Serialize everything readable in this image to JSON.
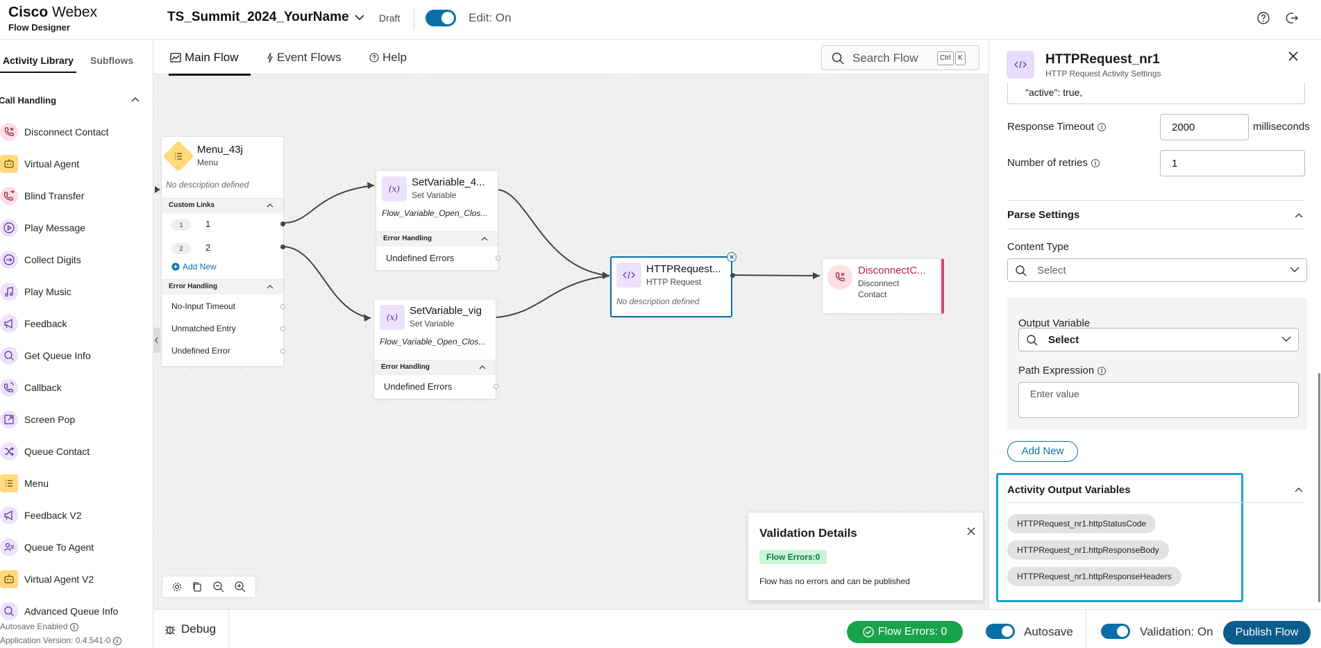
{
  "header": {
    "brand_company": "Cisco",
    "brand_product": "Webex",
    "brand_sub": "Flow Designer",
    "flow_name": "TS_Summit_2024_YourName",
    "status": "Draft",
    "edit_label": "Edit: On"
  },
  "sidebar": {
    "tabs": [
      "Activity Library",
      "Subflows"
    ],
    "category": "Call Handling",
    "items": [
      {
        "label": "Disconnect Contact",
        "icon": "phone-hangup-icon"
      },
      {
        "label": "Virtual Agent",
        "icon": "bot-icon"
      },
      {
        "label": "Blind Transfer",
        "icon": "transfer-icon"
      },
      {
        "label": "Play Message",
        "icon": "play-icon"
      },
      {
        "label": "Collect Digits",
        "icon": "digits-icon"
      },
      {
        "label": "Play Music",
        "icon": "music-icon"
      },
      {
        "label": "Feedback",
        "icon": "megaphone-icon"
      },
      {
        "label": "Get Queue Info",
        "icon": "search-icon"
      },
      {
        "label": "Callback",
        "icon": "callback-icon"
      },
      {
        "label": "Screen Pop",
        "icon": "external-link-icon"
      },
      {
        "label": "Queue Contact",
        "icon": "shuffle-icon"
      },
      {
        "label": "Menu",
        "icon": "menu-icon"
      },
      {
        "label": "Feedback V2",
        "icon": "megaphone-icon"
      },
      {
        "label": "Queue To Agent",
        "icon": "queue-agent-icon"
      },
      {
        "label": "Virtual Agent V2",
        "icon": "bot-icon"
      },
      {
        "label": "Advanced Queue Info",
        "icon": "search-icon"
      }
    ],
    "autosave_text": "Autosave Enabled",
    "version_text": "Application Version: 0.4.541-0"
  },
  "canvas": {
    "tabs": [
      "Main Flow",
      "Event Flows",
      "Help"
    ],
    "search_placeholder": "Search Flow",
    "kbd_ctrl": "Ctrl",
    "kbd_k": "K",
    "nodes": {
      "menu": {
        "title": "Menu_43j",
        "type": "Menu",
        "desc": "No description defined",
        "custom_links": "Custom Links",
        "links": [
          {
            "num": "1",
            "label": "1"
          },
          {
            "num": "2",
            "label": "2"
          }
        ],
        "add_new": "Add New",
        "error_handling": "Error Handling",
        "errors": [
          "No-Input Timeout",
          "Unmatched Entry",
          "Undefined Error"
        ]
      },
      "setvar1": {
        "title": "SetVariable_4...",
        "type": "Set Variable",
        "variable": "Flow_Variable_Open_Clos...",
        "error_handling": "Error Handling",
        "error": "Undefined Errors"
      },
      "setvar2": {
        "title": "SetVariable_vig",
        "type": "Set Variable",
        "variable": "Flow_Variable_Open_Clos...",
        "error_handling": "Error Handling",
        "error": "Undefined Errors"
      },
      "http": {
        "title": "HTTPRequest...",
        "type": "HTTP Request",
        "desc": "No description defined"
      },
      "disconnect": {
        "title": "DisconnectC...",
        "type_line1": "Disconnect",
        "type_line2": "Contact"
      }
    },
    "validation": {
      "title": "Validation Details",
      "badge": "Flow Errors:0",
      "message": "Flow has no errors and can be published"
    }
  },
  "panel": {
    "title": "HTTPRequest_nr1",
    "subtitle": "HTTP Request Activity Settings",
    "json_line": "\"active\": true,",
    "response_timeout_label": "Response Timeout",
    "response_timeout_value": "2000",
    "response_timeout_unit": "milliseconds",
    "retries_label": "Number of retries",
    "retries_value": "1",
    "parse_settings": "Parse Settings",
    "content_type_label": "Content Type",
    "content_type_placeholder": "Select",
    "output_variable_label": "Output Variable",
    "output_variable_value": "Select",
    "path_expression_label": "Path Expression",
    "path_expression_placeholder": "Enter value",
    "add_new": "Add New",
    "activity_output_variables": "Activity Output Variables",
    "output_vars": [
      "HTTPRequest_nr1.httpStatusCode",
      "HTTPRequest_nr1.httpResponseBody",
      "HTTPRequest_nr1.httpResponseHeaders"
    ]
  },
  "bottom": {
    "debug": "Debug",
    "flow_errors": "Flow Errors: 0",
    "autosave": "Autosave",
    "validation": "Validation: On",
    "publish": "Publish Flow"
  }
}
